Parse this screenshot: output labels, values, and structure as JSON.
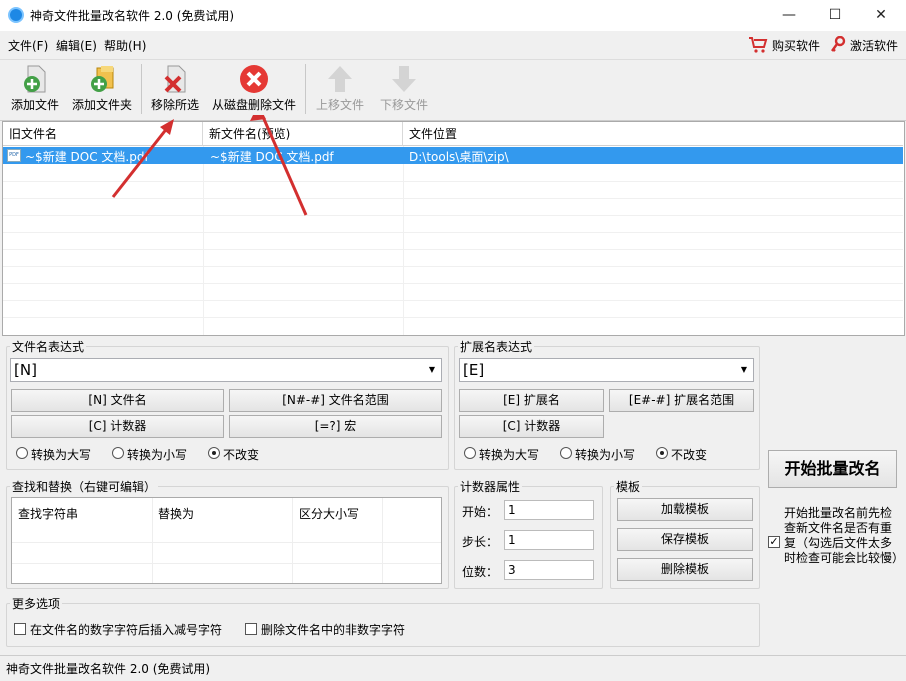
{
  "window": {
    "title": "神奇文件批量改名软件 2.0 (免费试用)",
    "controls": {
      "minimize": "—",
      "maximize": "☐",
      "close": "✕"
    }
  },
  "menu": {
    "items": [
      "文件(F)",
      "编辑(E)",
      "帮助(H)"
    ],
    "buy": "购买软件",
    "activate": "激活软件"
  },
  "toolbar": {
    "add_file": "添加文件",
    "add_folder": "添加文件夹",
    "remove_selected": "移除所选",
    "delete_from_disk": "从磁盘删除文件",
    "move_up": "上移文件",
    "move_down": "下移文件"
  },
  "filelist": {
    "columns": [
      "旧文件名",
      "新文件名(预览)",
      "文件位置"
    ],
    "rows": [
      {
        "old_name": "~$新建 DOC 文档.pdf",
        "new_name": "~$新建 DOC 文档.pdf",
        "location": "D:\\tools\\桌面\\zip\\"
      }
    ]
  },
  "filename_expr": {
    "label": "文件名表达式",
    "value": "[N]",
    "buttons": [
      "[N] 文件名",
      "[N#-#] 文件名范围",
      "[C] 计数器",
      "[=?] 宏"
    ],
    "case_options": [
      "转换为大写",
      "转换为小写",
      "不改变"
    ],
    "case_selected": "不改变"
  },
  "ext_expr": {
    "label": "扩展名表达式",
    "value": "[E]",
    "buttons": [
      "[E] 扩展名",
      "[E#-#] 扩展名范围",
      "[C] 计数器"
    ],
    "case_options": [
      "转换为大写",
      "转换为小写",
      "不改变"
    ],
    "case_selected": "不改变"
  },
  "start_button": "开始批量改名",
  "check_dup": {
    "checked": true,
    "text": "开始批量改名前先检查新文件名是否有重复（勾选后文件太多时检查可能会比较慢）"
  },
  "find_replace": {
    "label": "查找和替换（右键可编辑）",
    "columns": [
      "查找字符串",
      "替换为",
      "区分大小写"
    ]
  },
  "counter": {
    "label": "计数器属性",
    "start_label": "开始：",
    "start": "1",
    "step_label": "步长：",
    "step": "1",
    "digits_label": "位数：",
    "digits": "3"
  },
  "template": {
    "label": "模板",
    "load": "加载模板",
    "save": "保存模板",
    "delete": "删除模板"
  },
  "more": {
    "label": "更多选项",
    "opt1": "在文件名的数字字符后插入减号字符",
    "opt2": "删除文件名中的非数字字符"
  },
  "status": "神奇文件批量改名软件 2.0 (免费试用)",
  "colors": {
    "selection": "#3399ee",
    "accent_red": "#e53935",
    "accent_green": "#43a047"
  }
}
